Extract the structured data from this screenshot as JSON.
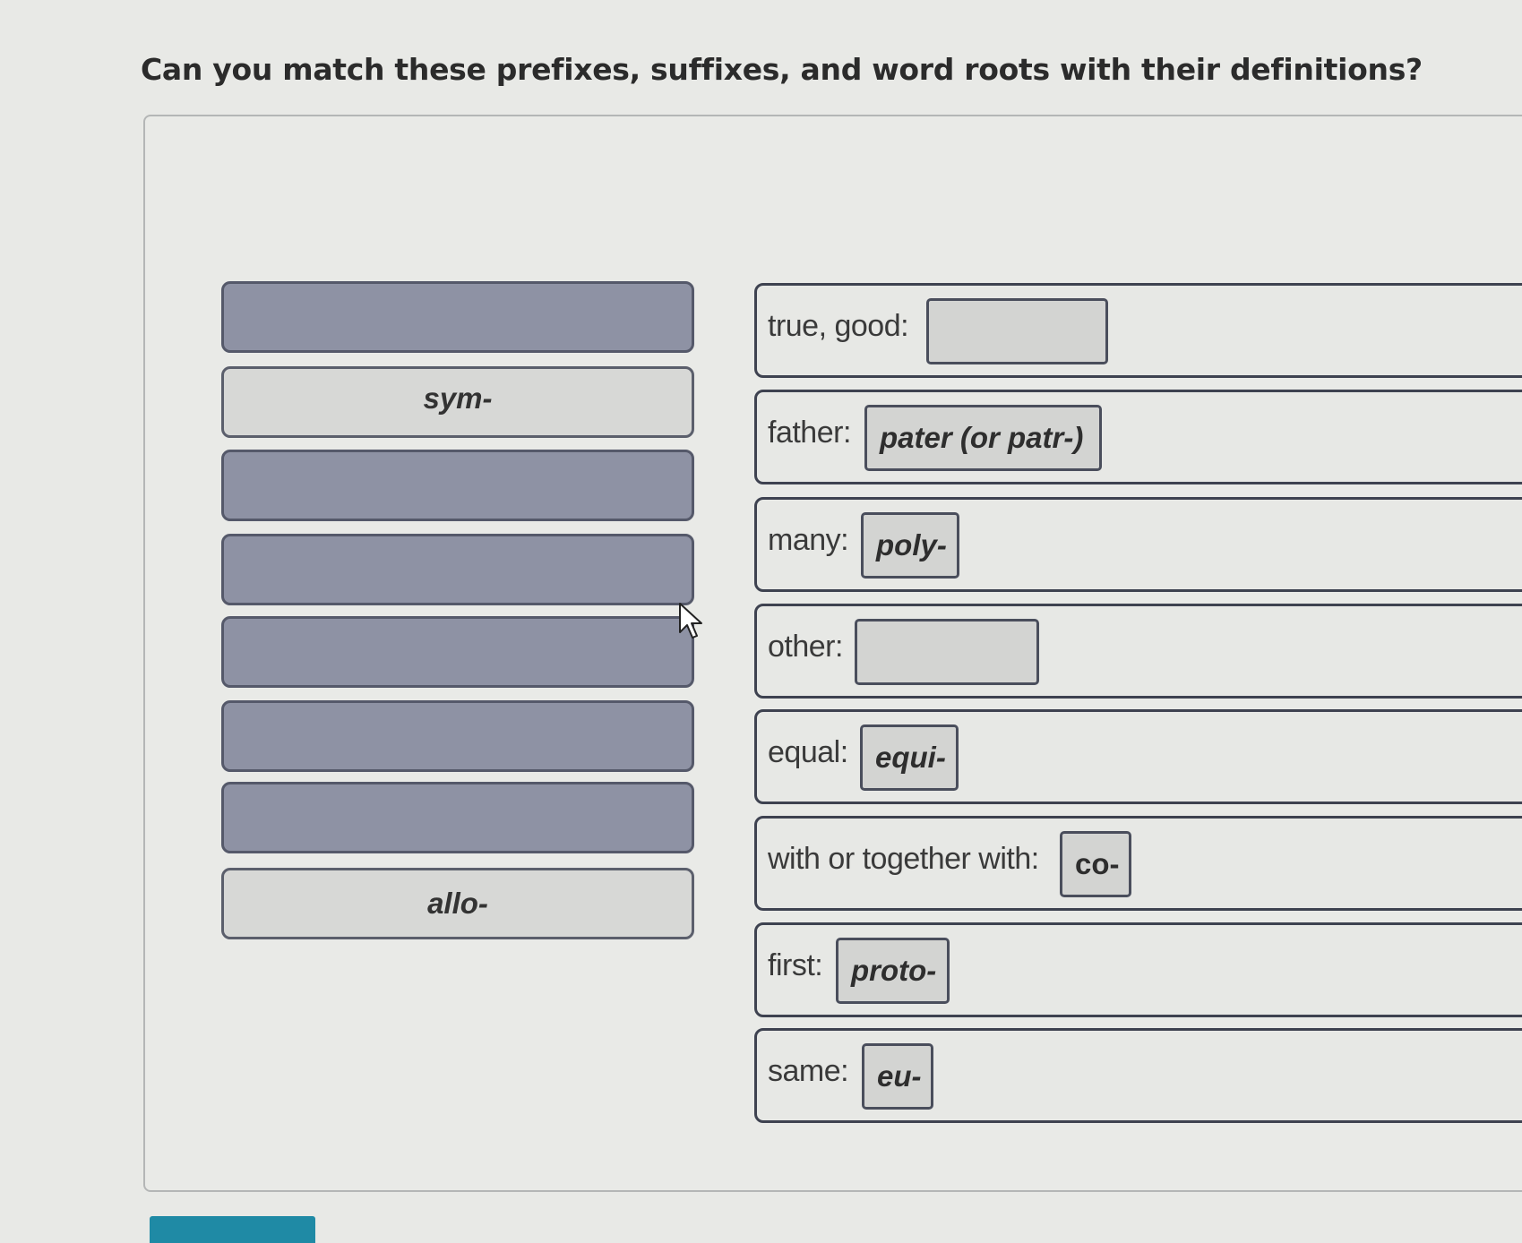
{
  "question": {
    "title": "Can you match these prefixes, suffixes, and word roots with their definitions?"
  },
  "answer_bank": {
    "tiles": [
      {
        "label": "",
        "state": "empty"
      },
      {
        "label": "sym-",
        "state": "filled"
      },
      {
        "label": "",
        "state": "empty"
      },
      {
        "label": "",
        "state": "empty"
      },
      {
        "label": "",
        "state": "empty"
      },
      {
        "label": "",
        "state": "empty"
      },
      {
        "label": "",
        "state": "empty"
      },
      {
        "label": "allo-",
        "state": "filled"
      }
    ]
  },
  "definitions": [
    {
      "label": "true, good:",
      "answer": ""
    },
    {
      "label": "father:",
      "answer": "pater (or patr-)"
    },
    {
      "label": "many:",
      "answer": "poly-"
    },
    {
      "label": "other:",
      "answer": ""
    },
    {
      "label": "equal:",
      "answer": "equi-"
    },
    {
      "label": "with or together with:",
      "answer": "co-"
    },
    {
      "label": "first:",
      "answer": "proto-"
    },
    {
      "label": "same:",
      "answer": "eu-"
    }
  ],
  "colors": {
    "empty_tile": "#8e92a4",
    "filled_tile": "#d7d8d6",
    "slot": "#d3d4d2",
    "accent_button": "#1f8aa5"
  }
}
